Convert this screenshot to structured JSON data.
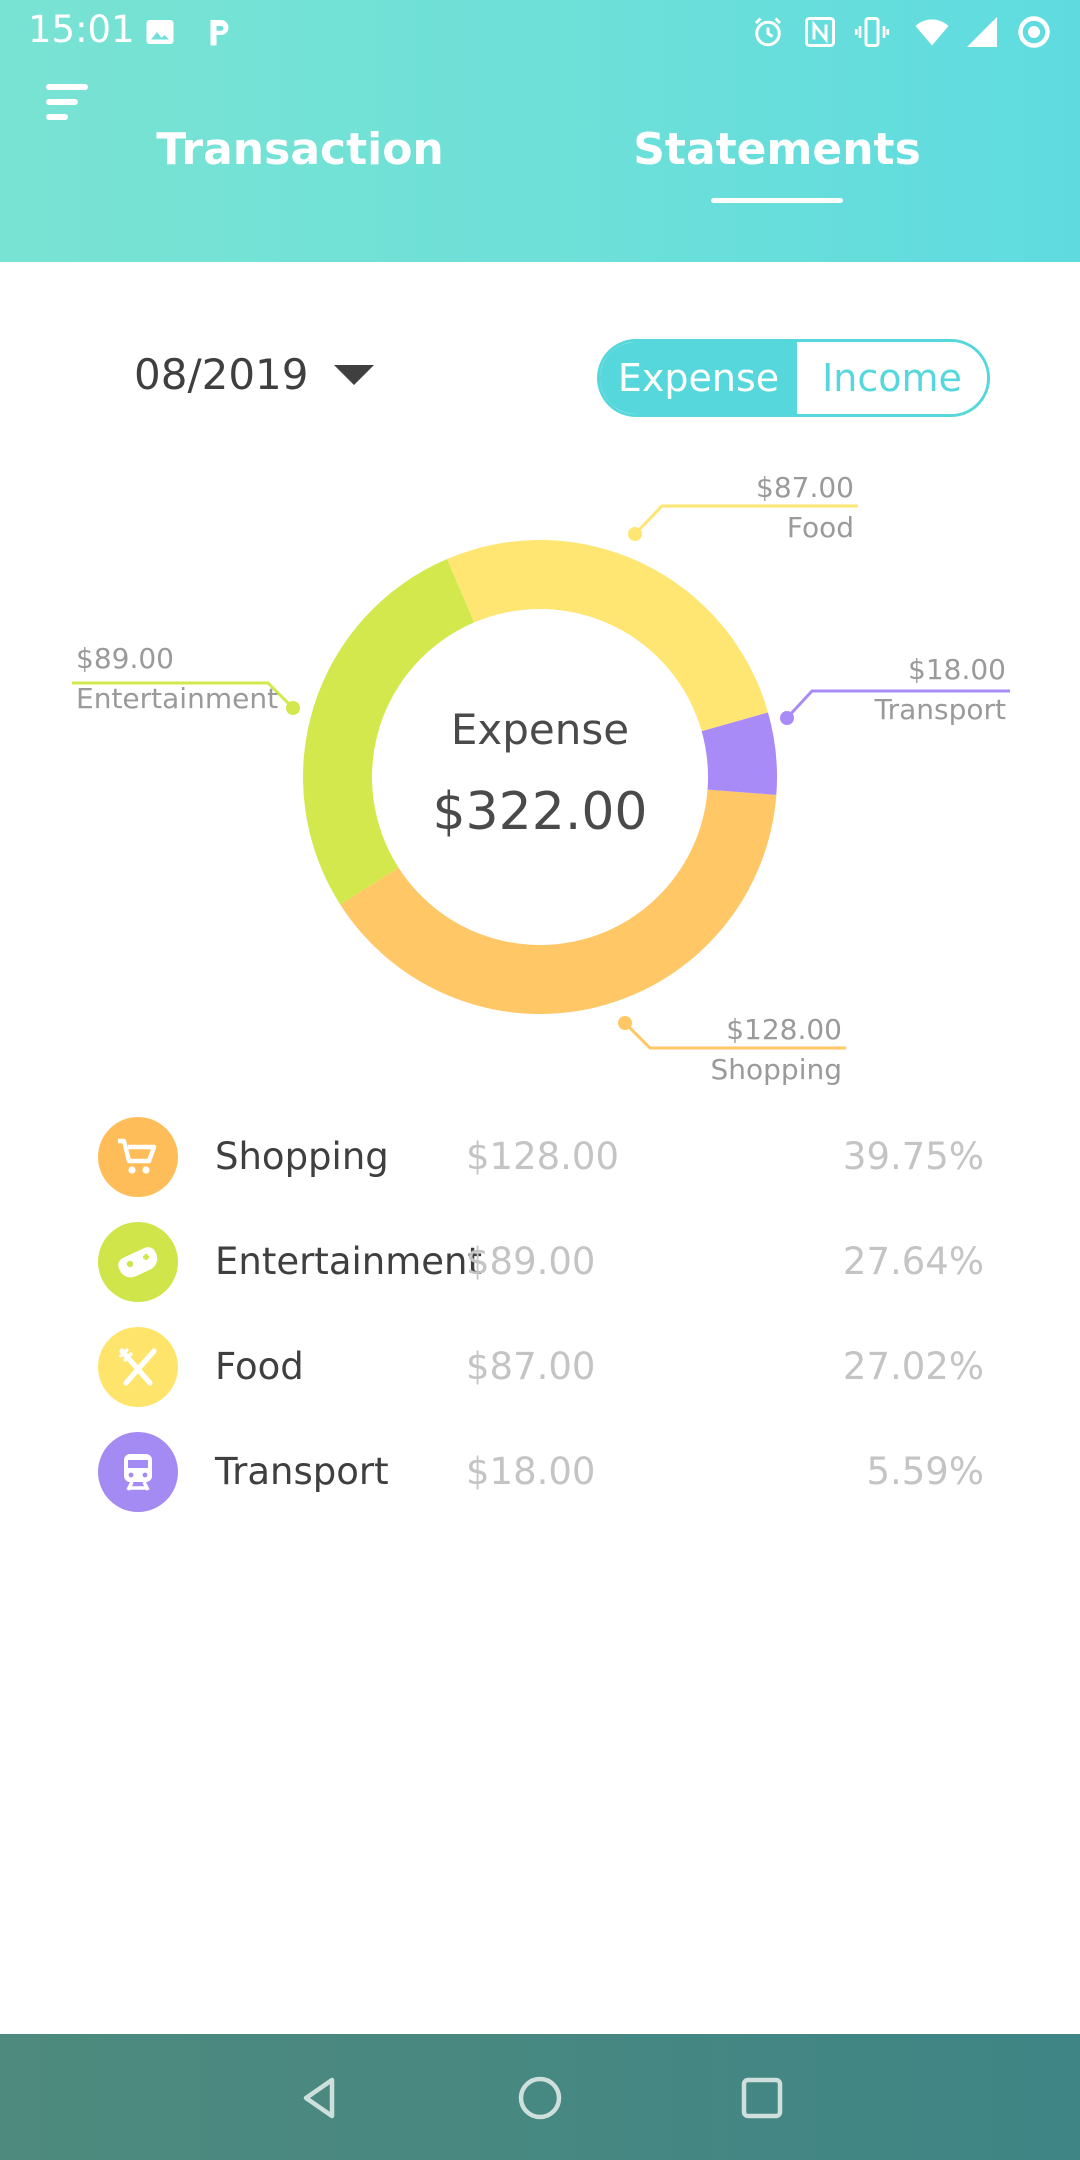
{
  "status_bar": {
    "time": "15:01",
    "left_icons": [
      "image-icon",
      "parking-icon"
    ],
    "right_icons": [
      "alarm-icon",
      "nfc-icon",
      "vibrate-icon",
      "wifi-icon",
      "signal-icon",
      "sync-icon"
    ]
  },
  "header": {
    "menu_icon": "menu-icon",
    "tabs": [
      {
        "label": "Transaction",
        "active": false
      },
      {
        "label": "Statements",
        "active": true
      }
    ]
  },
  "controls": {
    "month": "08/2019",
    "toggle": {
      "expense_label": "Expense",
      "income_label": "Income",
      "selected": "Expense"
    }
  },
  "chart_data": {
    "type": "pie",
    "donut": true,
    "center_title": "Expense",
    "center_value": "$322.00",
    "categories": [
      "Shopping",
      "Entertainment",
      "Food",
      "Transport"
    ],
    "values": [
      128.0,
      89.0,
      87.0,
      18.0
    ],
    "value_labels": [
      "$128.00",
      "$89.00",
      "$87.00",
      "$18.00"
    ],
    "colors": [
      "#ffc766",
      "#d3e84c",
      "#ffe673",
      "#a98bf7"
    ]
  },
  "breakdown": [
    {
      "name": "Shopping",
      "amount": "$128.00",
      "percent": "39.75%",
      "icon": "cart-icon",
      "color": "#ffbd59"
    },
    {
      "name": "Entertainment",
      "amount": "$89.00",
      "percent": "27.64%",
      "icon": "gamepad-icon",
      "color": "#cfe54a"
    },
    {
      "name": "Food",
      "amount": "$87.00",
      "percent": "27.02%",
      "icon": "fork-knife-icon",
      "color": "#ffe46b"
    },
    {
      "name": "Transport",
      "amount": "$18.00",
      "percent": "5.59%",
      "icon": "train-icon",
      "color": "#a48af3"
    }
  ],
  "nav": {
    "icons": [
      "back-icon",
      "home-icon",
      "recents-icon"
    ]
  }
}
